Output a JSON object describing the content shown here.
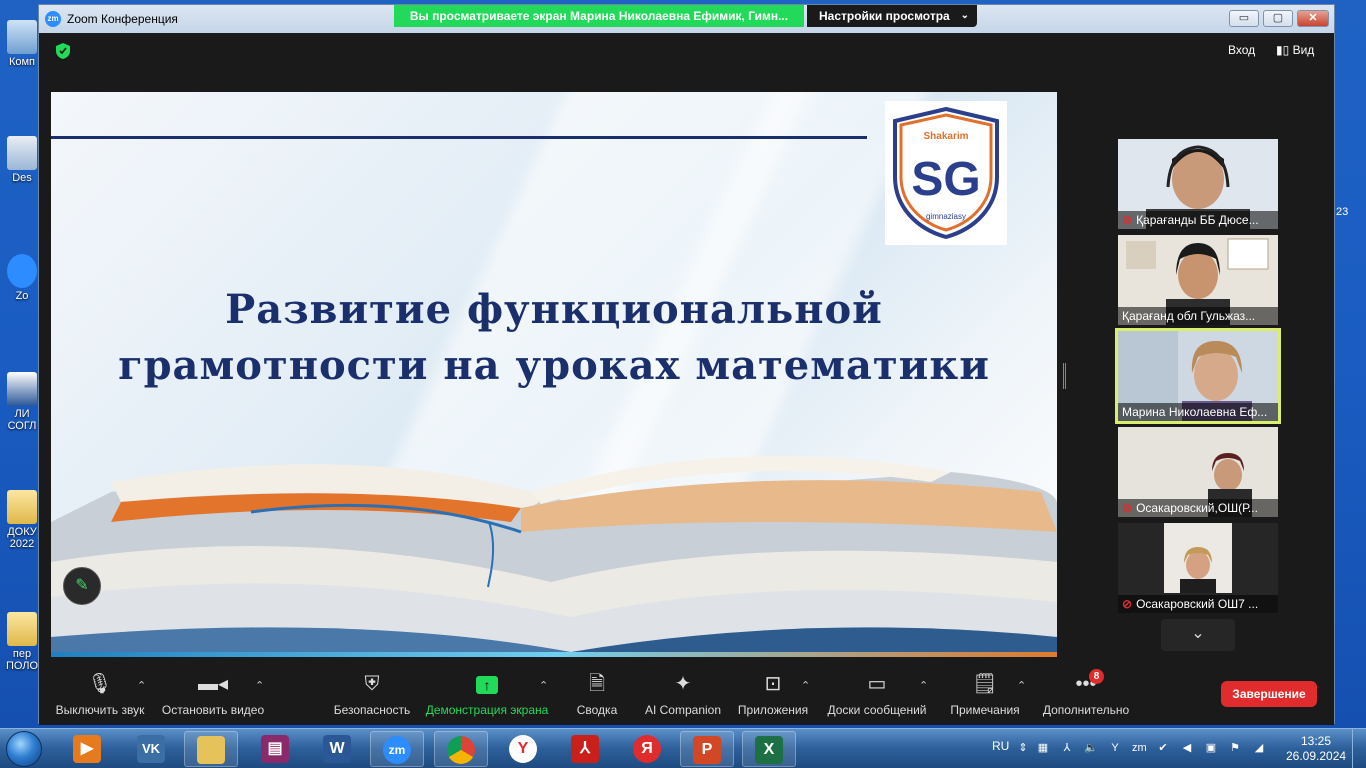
{
  "desktop": {
    "icons": [
      "Комп",
      "Des",
      "Zo",
      "ЛИ СОГЛ",
      "ДОКУ 2022",
      "пер ПОЛО"
    ],
    "right_fragments": [
      "23"
    ]
  },
  "window": {
    "title": "Zoom Конференция",
    "logo": "zm",
    "minimize": "▭",
    "maximize": "▢",
    "close": "✕"
  },
  "share_banner": "Вы просматриваете экран Марина Николаевна Ефимик, Гимн...",
  "view_options": {
    "label": "Настройки просмотра",
    "icon": "chevron-down-icon"
  },
  "topbar": {
    "enter": "Вход",
    "view": "Вид"
  },
  "slide": {
    "logo_top": "Shakarim",
    "logo_letters": "SG",
    "logo_bottom": "gimnaziasy",
    "title_line1": "Развитие функциональной",
    "title_line2": "грамотности на уроках математики"
  },
  "participants": [
    {
      "name": "Қарағанды ББ Дюсе...",
      "muted": true,
      "active": false
    },
    {
      "name": "Қарағанд обл  Гульжаз...",
      "muted": false,
      "active": false
    },
    {
      "name": "Марина Николаевна Еф...",
      "muted": false,
      "active": true
    },
    {
      "name": "Осакаровский,ОШ(Р...",
      "muted": true,
      "active": false
    },
    {
      "name": "Осакаровский ОШ7 ...",
      "muted": true,
      "active": false
    }
  ],
  "toolbar": {
    "mute": "Выключить звук",
    "video": "Остановить видео",
    "security": "Безопасность",
    "share": "Демонстрация экрана",
    "summary": "Сводка",
    "ai": "AI Companion",
    "apps": "Приложения",
    "whiteboards": "Доски сообщений",
    "notes": "Примечания",
    "more": "Дополнительно",
    "more_badge": "8",
    "end": "Завершение"
  },
  "taskbar": {
    "lang": "RU",
    "time": "13:25",
    "date": "26.09.2024",
    "apps": [
      "media-player",
      "vk",
      "explorer",
      "winrar",
      "word",
      "zoom",
      "chrome",
      "yandex-browser",
      "pdf",
      "yandex",
      "powerpoint",
      "excel"
    ]
  },
  "colors": {
    "zoom_blue": "#2d8cff",
    "share_green": "#23d959",
    "end_red": "#e02c2c",
    "slide_title": "#1a2f6b",
    "active_speaker": "#d9ef6a"
  }
}
